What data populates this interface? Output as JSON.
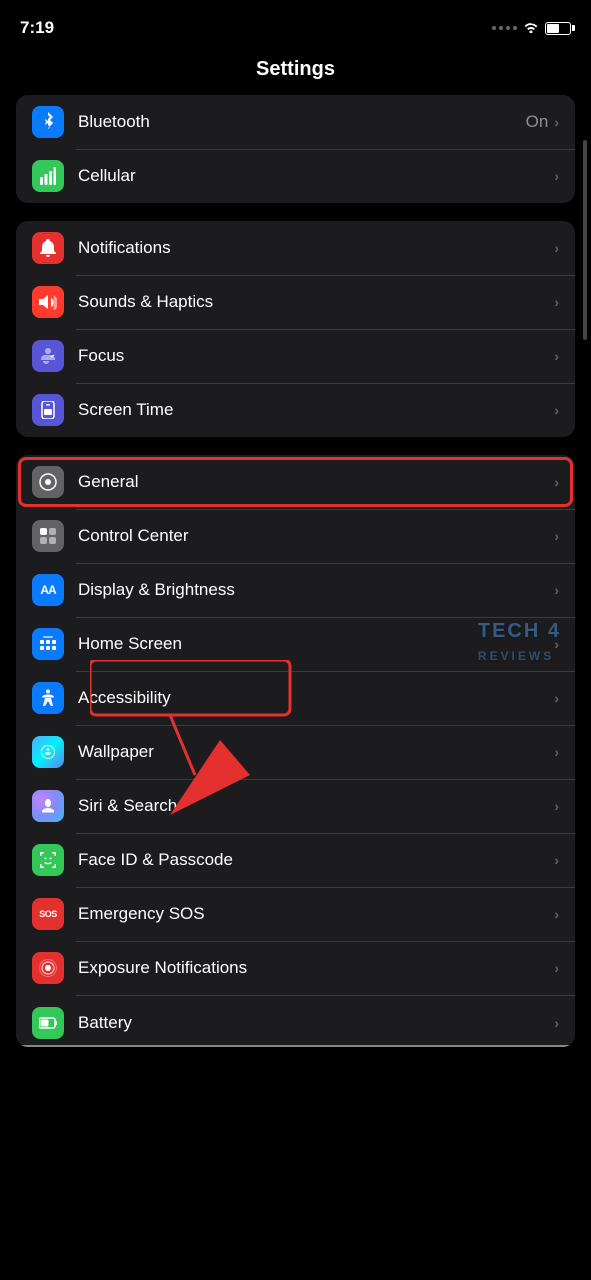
{
  "status": {
    "time": "7:19",
    "signal": "signal",
    "wifi": "wifi",
    "battery": "battery"
  },
  "header": {
    "title": "Settings"
  },
  "groups": [
    {
      "id": "group1",
      "rows": [
        {
          "id": "bluetooth",
          "label": "Bluetooth",
          "value": "On",
          "icon": "bluetooth",
          "iconBg": "icon-blue",
          "iconChar": "⊛"
        },
        {
          "id": "cellular",
          "label": "Cellular",
          "value": "",
          "icon": "cellular",
          "iconBg": "icon-green",
          "iconChar": "📶"
        }
      ]
    },
    {
      "id": "group2",
      "rows": [
        {
          "id": "notifications",
          "label": "Notifications",
          "value": "",
          "icon": "notifications",
          "iconBg": "icon-red",
          "iconChar": "🔔"
        },
        {
          "id": "sounds",
          "label": "Sounds & Haptics",
          "value": "",
          "icon": "sounds",
          "iconBg": "icon-orange-red",
          "iconChar": "🔊"
        },
        {
          "id": "focus",
          "label": "Focus",
          "value": "",
          "icon": "focus",
          "iconBg": "icon-indigo",
          "iconChar": "🌙"
        },
        {
          "id": "screentime",
          "label": "Screen Time",
          "value": "",
          "icon": "screentime",
          "iconBg": "icon-indigo",
          "iconChar": "⏳"
        }
      ]
    },
    {
      "id": "group3",
      "rows": [
        {
          "id": "general",
          "label": "General",
          "value": "",
          "icon": "general",
          "iconBg": "icon-gray",
          "iconChar": "⚙️",
          "highlighted": true
        },
        {
          "id": "controlcenter",
          "label": "Control Center",
          "value": "",
          "icon": "controlcenter",
          "iconBg": "icon-gray",
          "iconChar": "🎛"
        },
        {
          "id": "display",
          "label": "Display & Brightness",
          "value": "",
          "icon": "display",
          "iconBg": "icon-aa",
          "iconChar": "AA"
        },
        {
          "id": "homescreen",
          "label": "Home Screen",
          "value": "",
          "icon": "homescreen",
          "iconBg": "icon-homescreen",
          "iconChar": "⊞"
        },
        {
          "id": "accessibility",
          "label": "Accessibility",
          "value": "",
          "icon": "accessibility",
          "iconBg": "icon-accessibility",
          "iconChar": "♿"
        },
        {
          "id": "wallpaper",
          "label": "Wallpaper",
          "value": "",
          "icon": "wallpaper",
          "iconBg": "icon-wallpaper",
          "iconChar": "❁"
        },
        {
          "id": "siri",
          "label": "Siri & Search",
          "value": "",
          "icon": "siri",
          "iconBg": "icon-siri",
          "iconChar": "◎"
        },
        {
          "id": "faceid",
          "label": "Face ID & Passcode",
          "value": "",
          "icon": "faceid",
          "iconBg": "icon-faceid",
          "iconChar": "😊"
        },
        {
          "id": "sos",
          "label": "Emergency SOS",
          "value": "",
          "icon": "sos",
          "iconBg": "icon-sos",
          "iconChar": "SOS"
        },
        {
          "id": "exposure",
          "label": "Exposure Notifications",
          "value": "",
          "icon": "exposure",
          "iconBg": "icon-exposure",
          "iconChar": "◉"
        },
        {
          "id": "battery",
          "label": "Battery",
          "value": "",
          "icon": "battery",
          "iconBg": "icon-battery",
          "iconChar": "🔋"
        }
      ]
    }
  ]
}
